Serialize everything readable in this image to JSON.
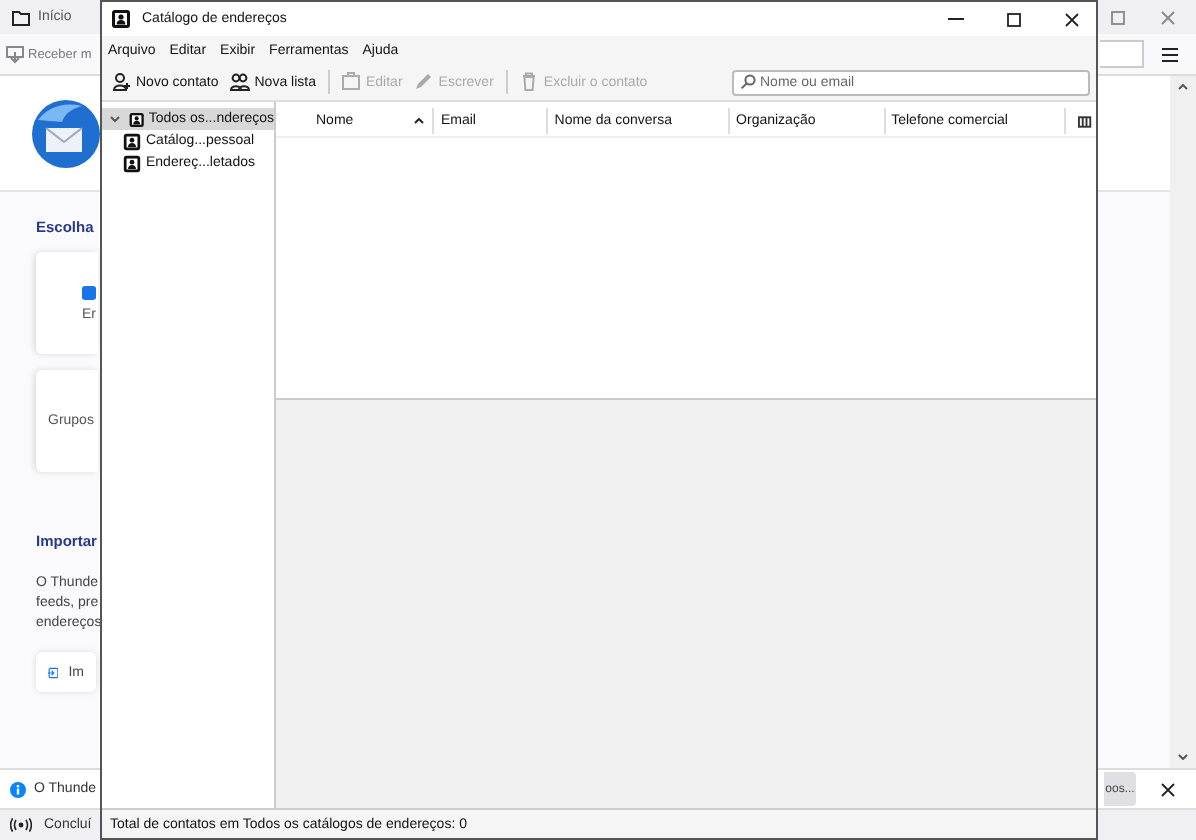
{
  "background_window": {
    "tab_title": "Início",
    "get_messages": "Receber m",
    "setup_heading": "Escolha",
    "setup_cards": [
      {
        "label": "Er",
        "kind": "icon"
      },
      {
        "label": "Grupos",
        "kind": "plain"
      }
    ],
    "import_heading": "Importar",
    "import_text_lines": [
      "O Thunde",
      "feeds, pre",
      "endereços"
    ],
    "import_button": "Im",
    "notification": {
      "text": "O Thunde",
      "button": "oos..."
    },
    "status": "Concluí"
  },
  "address_book": {
    "title": "Catálogo de endereços",
    "menus": [
      "Arquivo",
      "Editar",
      "Exibir",
      "Ferramentas",
      "Ajuda"
    ],
    "toolbar": [
      {
        "kind": "new-contact",
        "label": "Novo contato",
        "disabled": false
      },
      {
        "kind": "new-list",
        "label": "Nova lista",
        "disabled": false
      },
      {
        "kind": "separator"
      },
      {
        "kind": "edit",
        "label": "Editar",
        "disabled": true
      },
      {
        "kind": "write",
        "label": "Escrever",
        "disabled": true
      },
      {
        "kind": "separator"
      },
      {
        "kind": "delete",
        "label": "Excluir o contato",
        "disabled": true
      }
    ],
    "search": {
      "placeholder": "Nome ou email"
    },
    "books": [
      {
        "label": "Todos os...ndereços",
        "selected": true,
        "expanded": true,
        "children": [
          {
            "label": "Catálog...pessoal",
            "selected": false
          },
          {
            "label": "Endereç...letados",
            "selected": false
          }
        ]
      }
    ],
    "columns": [
      {
        "label": "Nome",
        "sorted": true
      },
      {
        "label": "Email",
        "sorted": false
      },
      {
        "label": "Nome da conversa",
        "sorted": false
      },
      {
        "label": "Organização",
        "sorted": false
      },
      {
        "label": "Telefone comercial",
        "sorted": false
      }
    ],
    "status": "Total de contatos em Todos os catálogos de endereços: 0"
  }
}
